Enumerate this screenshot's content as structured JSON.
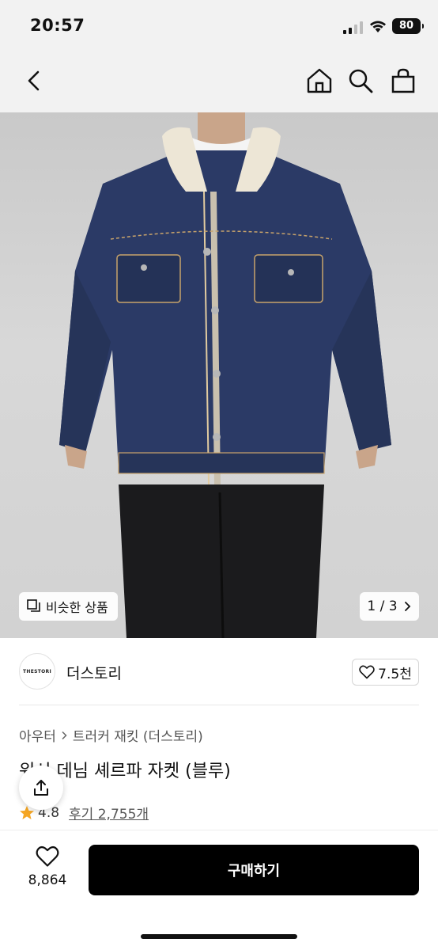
{
  "status": {
    "time": "20:57",
    "battery": "80"
  },
  "gallery": {
    "similar_label": "비슷한 상품",
    "pager": "1 / 3"
  },
  "brand": {
    "name": "더스토리",
    "logo_text": "THESTORI",
    "like_count": "7.5천"
  },
  "product": {
    "category": "아우터",
    "subcategory": "트러커 재킷 (더스토리)",
    "title": "워시 데님 셰르파 자켓 (블루)",
    "rating": "4.8",
    "reviews": "후기 2,755개"
  },
  "bottom": {
    "wish_count": "8,864",
    "buy_label": "구매하기"
  },
  "colors": {
    "accent": "#000000",
    "star": "#f5a623",
    "denim": "#2b3a66"
  }
}
